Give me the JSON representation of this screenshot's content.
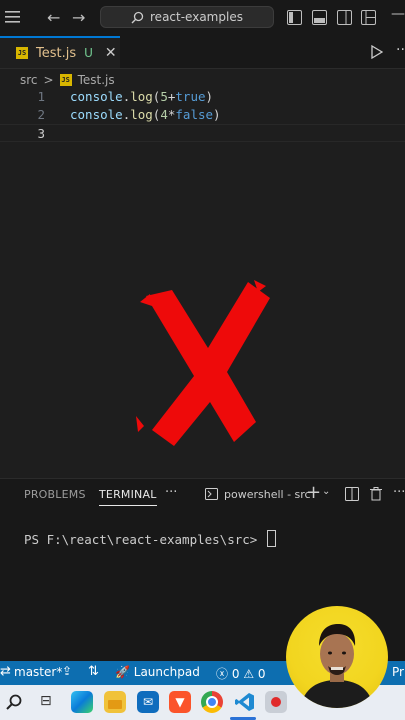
{
  "titlebar": {
    "search_text": "react-examples",
    "icons": [
      "menu-icon",
      "back-arrow-icon",
      "forward-arrow-icon",
      "search-icon",
      "toggle-sidebar-icon",
      "toggle-panel-icon",
      "toggle-secondary-sidebar-icon",
      "customize-layout-icon",
      "minimize-icon"
    ]
  },
  "editor": {
    "tab": {
      "file_name": "Test.js",
      "status": "U",
      "close": "✕",
      "badge": "JS"
    },
    "breadcrumb": {
      "folder": "src",
      "separator": ">",
      "file": "Test.js"
    },
    "lines": [
      {
        "number": "1",
        "tokens": [
          {
            "t": "console",
            "c": "id"
          },
          {
            "t": ".",
            "c": "p"
          },
          {
            "t": "log",
            "c": "fn"
          },
          {
            "t": "(",
            "c": "p"
          },
          {
            "t": "5",
            "c": "num"
          },
          {
            "t": "+",
            "c": "p"
          },
          {
            "t": "true",
            "c": "kw"
          },
          {
            "t": ")",
            "c": "p"
          }
        ]
      },
      {
        "number": "2",
        "tokens": [
          {
            "t": "console",
            "c": "id"
          },
          {
            "t": ".",
            "c": "p"
          },
          {
            "t": "log",
            "c": "fn"
          },
          {
            "t": "(",
            "c": "p"
          },
          {
            "t": "4",
            "c": "num"
          },
          {
            "t": "*",
            "c": "p"
          },
          {
            "t": "false",
            "c": "kw"
          },
          {
            "t": ")",
            "c": "p"
          }
        ]
      },
      {
        "number": "3",
        "tokens": []
      }
    ],
    "overlay": {
      "icon": "red-x-mark-icon",
      "color": "#ee0a0a"
    }
  },
  "panel": {
    "tabs": [
      {
        "label": "PROBLEMS",
        "active": false
      },
      {
        "label": "TERMINAL",
        "active": true
      }
    ],
    "more": "···",
    "terminal_name": "powershell - src",
    "plus": "+",
    "prompt": "PS F:\\react\\react-examples\\src> "
  },
  "statusbar": {
    "branch": "master*",
    "launchpad": "Launchpad",
    "errors": "0",
    "warnings": "0",
    "prettier": "Pr",
    "color": "#0d6eb0"
  },
  "taskbar": {
    "icons": [
      "windows-search-icon",
      "task-view-icon",
      "edge-icon",
      "file-explorer-icon",
      "mail-icon",
      "brave-icon",
      "chrome-icon",
      "vscode-icon",
      "recording-icon"
    ]
  }
}
